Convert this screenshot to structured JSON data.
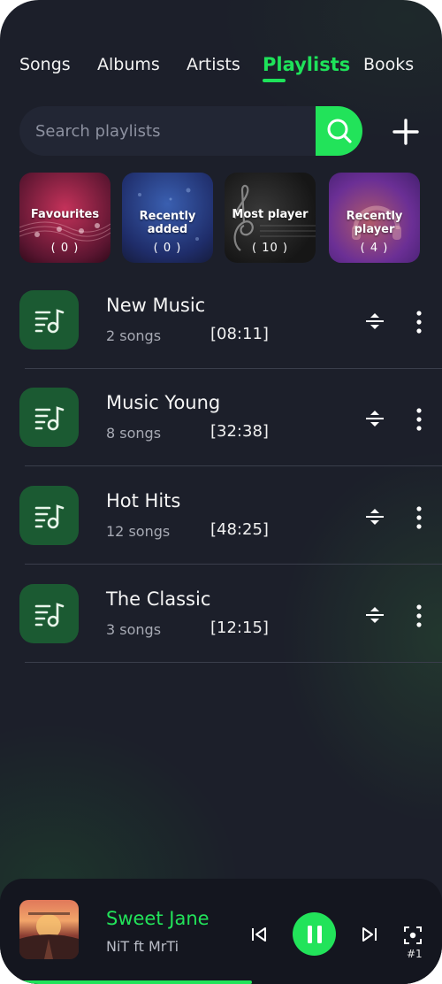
{
  "tabs": [
    {
      "label": "Songs"
    },
    {
      "label": "Albums"
    },
    {
      "label": "Artists"
    },
    {
      "label": "Playlists",
      "active": true
    },
    {
      "label": "Books"
    }
  ],
  "search": {
    "placeholder": "Search playlists",
    "value": ""
  },
  "tiles": [
    {
      "title_line1": "Favourites",
      "title_line2": "",
      "count": "( 0 )"
    },
    {
      "title_line1": "Recently",
      "title_line2": "added",
      "count": "( 0 )"
    },
    {
      "title_line1": "Most player",
      "title_line2": "",
      "count": "( 10 )"
    },
    {
      "title_line1": "Recently",
      "title_line2": "player",
      "count": "( 4 )"
    }
  ],
  "playlists": [
    {
      "title": "New Music",
      "songs": "2 songs",
      "duration": "[08:11]"
    },
    {
      "title": "Music Young",
      "songs": "8 songs",
      "duration": "[32:38]"
    },
    {
      "title": "Hot Hits",
      "songs": "12 songs",
      "duration": "[48:25]"
    },
    {
      "title": "The Classic",
      "songs": "3 songs",
      "duration": "[12:15]"
    }
  ],
  "player": {
    "title": "Sweet Jane",
    "artist": "NiT ft MrTi",
    "queue_label": "#1",
    "progress": 0.57
  },
  "colors": {
    "accent": "#22e35a",
    "background": "#1c1f2a",
    "icon_tile": "#1b5a32"
  }
}
